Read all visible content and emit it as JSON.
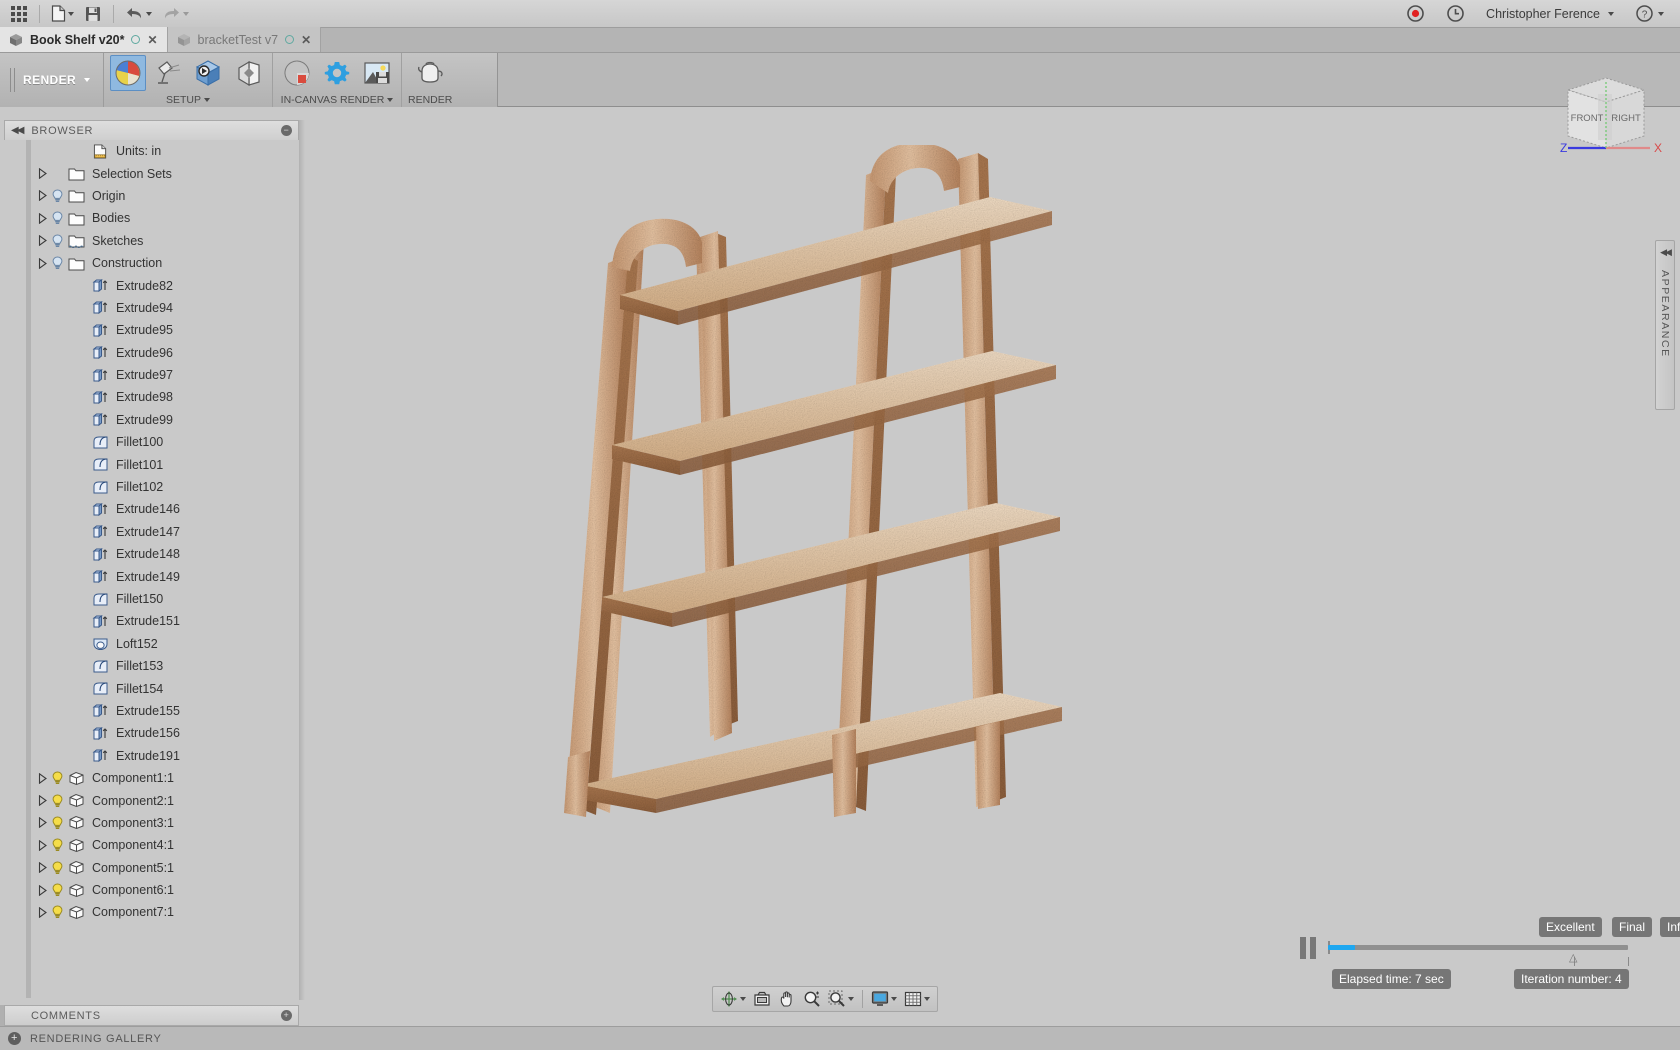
{
  "quick_access": {
    "app_grid_label": "app-grid",
    "items": [
      {
        "name": "new-file",
        "label": "New",
        "has_caret": true
      },
      {
        "name": "save",
        "label": "Save",
        "has_caret": false
      },
      {
        "name": "undo",
        "label": "Undo",
        "has_caret": true
      },
      {
        "name": "redo",
        "label": "Redo",
        "has_caret": true
      }
    ],
    "record_button": "record-icon",
    "history_button": "clock-icon",
    "user_name": "Christopher Ference",
    "help_label": "?"
  },
  "document_tabs": [
    {
      "title": "Book Shelf v20*",
      "active": true
    },
    {
      "title": "bracketTest v7",
      "active": false
    }
  ],
  "ribbon": {
    "workspace": "RENDER",
    "groups": [
      {
        "label": "SETUP",
        "has_caret": true,
        "tools": [
          {
            "name": "appearance-tool",
            "selected": true
          },
          {
            "name": "scene-settings-tool",
            "selected": false
          },
          {
            "name": "texture-map-controls-tool",
            "selected": false
          },
          {
            "name": "decal-tool",
            "selected": false
          }
        ]
      },
      {
        "label": "IN-CANVAS RENDER",
        "has_caret": true,
        "tools": [
          {
            "name": "in-canvas-render-toggle",
            "selected": false
          },
          {
            "name": "in-canvas-render-settings",
            "selected": false
          },
          {
            "name": "capture-image-tool",
            "selected": false
          }
        ]
      },
      {
        "label": "RENDER",
        "has_caret": false,
        "tools": [
          {
            "name": "render-tool",
            "selected": false
          }
        ]
      }
    ]
  },
  "browser": {
    "title": "BROWSER",
    "collapse_icon": "double-left-arrow-icon",
    "options_icon": "circle-plus-icon",
    "tree": [
      {
        "label": "Units: in",
        "icon": "document-units-icon",
        "arrow": false,
        "bulb": false,
        "indent": 2
      },
      {
        "label": "Selection Sets",
        "icon": "folder-icon",
        "arrow": true,
        "bulb": false,
        "indent": 1
      },
      {
        "label": "Origin",
        "icon": "folder-icon",
        "arrow": true,
        "bulb": "off",
        "indent": 1
      },
      {
        "label": "Bodies",
        "icon": "folder-icon",
        "arrow": true,
        "bulb": "off",
        "indent": 1
      },
      {
        "label": "Sketches",
        "icon": "sketch-folder-icon",
        "arrow": true,
        "bulb": "off",
        "indent": 1
      },
      {
        "label": "Construction",
        "icon": "folder-icon",
        "arrow": true,
        "bulb": "off",
        "indent": 1
      },
      {
        "label": "Extrude82",
        "icon": "extrude-icon",
        "arrow": false,
        "bulb": false,
        "indent": 2
      },
      {
        "label": "Extrude94",
        "icon": "extrude-icon",
        "arrow": false,
        "bulb": false,
        "indent": 2
      },
      {
        "label": "Extrude95",
        "icon": "extrude-icon",
        "arrow": false,
        "bulb": false,
        "indent": 2
      },
      {
        "label": "Extrude96",
        "icon": "extrude-icon",
        "arrow": false,
        "bulb": false,
        "indent": 2
      },
      {
        "label": "Extrude97",
        "icon": "extrude-icon",
        "arrow": false,
        "bulb": false,
        "indent": 2
      },
      {
        "label": "Extrude98",
        "icon": "extrude-icon",
        "arrow": false,
        "bulb": false,
        "indent": 2
      },
      {
        "label": "Extrude99",
        "icon": "extrude-icon",
        "arrow": false,
        "bulb": false,
        "indent": 2
      },
      {
        "label": "Fillet100",
        "icon": "fillet-icon",
        "arrow": false,
        "bulb": false,
        "indent": 2
      },
      {
        "label": "Fillet101",
        "icon": "fillet-icon",
        "arrow": false,
        "bulb": false,
        "indent": 2
      },
      {
        "label": "Fillet102",
        "icon": "fillet-icon",
        "arrow": false,
        "bulb": false,
        "indent": 2
      },
      {
        "label": "Extrude146",
        "icon": "extrude-icon",
        "arrow": false,
        "bulb": false,
        "indent": 2
      },
      {
        "label": "Extrude147",
        "icon": "extrude-icon",
        "arrow": false,
        "bulb": false,
        "indent": 2
      },
      {
        "label": "Extrude148",
        "icon": "extrude-icon",
        "arrow": false,
        "bulb": false,
        "indent": 2
      },
      {
        "label": "Extrude149",
        "icon": "extrude-icon",
        "arrow": false,
        "bulb": false,
        "indent": 2
      },
      {
        "label": "Fillet150",
        "icon": "fillet-icon",
        "arrow": false,
        "bulb": false,
        "indent": 2
      },
      {
        "label": "Extrude151",
        "icon": "extrude-icon",
        "arrow": false,
        "bulb": false,
        "indent": 2
      },
      {
        "label": "Loft152",
        "icon": "loft-icon",
        "arrow": false,
        "bulb": false,
        "indent": 2
      },
      {
        "label": "Fillet153",
        "icon": "fillet-icon",
        "arrow": false,
        "bulb": false,
        "indent": 2
      },
      {
        "label": "Fillet154",
        "icon": "fillet-icon",
        "arrow": false,
        "bulb": false,
        "indent": 2
      },
      {
        "label": "Extrude155",
        "icon": "extrude-icon",
        "arrow": false,
        "bulb": false,
        "indent": 2
      },
      {
        "label": "Extrude156",
        "icon": "extrude-icon",
        "arrow": false,
        "bulb": false,
        "indent": 2
      },
      {
        "label": "Extrude191",
        "icon": "extrude-icon",
        "arrow": false,
        "bulb": false,
        "indent": 2
      },
      {
        "label": "Component1:1",
        "icon": "component-icon",
        "arrow": true,
        "bulb": "on",
        "indent": 1
      },
      {
        "label": "Component2:1",
        "icon": "component-icon",
        "arrow": true,
        "bulb": "on",
        "indent": 1
      },
      {
        "label": "Component3:1",
        "icon": "component-icon",
        "arrow": true,
        "bulb": "on",
        "indent": 1
      },
      {
        "label": "Component4:1",
        "icon": "component-icon",
        "arrow": true,
        "bulb": "on",
        "indent": 1
      },
      {
        "label": "Component5:1",
        "icon": "component-icon",
        "arrow": true,
        "bulb": "on",
        "indent": 1
      },
      {
        "label": "Component6:1",
        "icon": "component-icon",
        "arrow": true,
        "bulb": "on",
        "indent": 1
      },
      {
        "label": "Component7:1",
        "icon": "component-icon",
        "arrow": true,
        "bulb": "on",
        "indent": 1
      }
    ]
  },
  "view_cube": {
    "face_front": "FRONT",
    "face_right": "RIGHT",
    "axis_z": "Z",
    "axis_x": "X",
    "axis_z_color": "#3a3adf",
    "axis_x_color": "#d94a4a"
  },
  "appearance_panel": {
    "title": "APPEARANCE",
    "collapse_icon": "double-left-arrow-icon"
  },
  "render_progress": {
    "pause_label": "pause",
    "progress_percent": 9,
    "quality_markers": [
      {
        "label": "Excellent",
        "position_percent": 82
      },
      {
        "label": "Final",
        "position_percent": 100
      },
      {
        "label": "Infinite",
        "position_percent": 118
      }
    ],
    "elapsed_time": "Elapsed time: 7 sec",
    "iteration": "Iteration number: 4",
    "progress_color": "#1ea7f0"
  },
  "nav_toolbar": [
    {
      "name": "orbit-icon",
      "has_caret": true
    },
    {
      "name": "look-at-icon",
      "has_caret": false
    },
    {
      "name": "pan-icon",
      "has_caret": false
    },
    {
      "name": "zoom-icon",
      "has_caret": false
    },
    {
      "name": "fit-icon",
      "has_caret": true
    },
    {
      "name": "display-settings-icon",
      "has_caret": true
    },
    {
      "name": "grid-snaps-icon",
      "has_caret": true
    }
  ],
  "comments": {
    "title": "COMMENTS",
    "options_icon": "circle-plus-icon"
  },
  "rendering_gallery": {
    "title": "RENDERING GALLERY",
    "expand_icon": "circle-plus-icon"
  },
  "model": {
    "name": "bookshelf-render",
    "description": "Wood bookshelf ladder-style render"
  }
}
